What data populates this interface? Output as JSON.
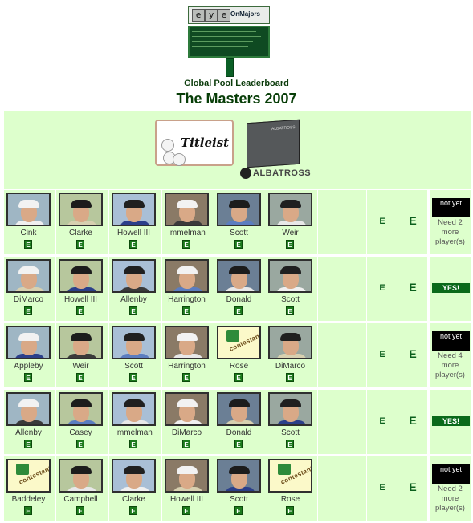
{
  "header": {
    "logo_letters": [
      "e",
      "y",
      "e"
    ],
    "logo_word": "OnMajors",
    "subtitle": "Global Pool Leaderboard",
    "title": "The Masters 2007"
  },
  "banner": {
    "ball_brand": "Titleist",
    "sponsor": "ALBATROSS"
  },
  "rows": [
    {
      "players": [
        "Cink",
        "Clarke",
        "Howell III",
        "Immelman",
        "Scott",
        "Weir"
      ],
      "score1": "E",
      "score2": "E",
      "status": {
        "type": "notyet",
        "badge": "not yet",
        "note": "Need 2 more player(s)"
      }
    },
    {
      "players": [
        "DiMarco",
        "Howell III",
        "Allenby",
        "Harrington",
        "Donald",
        "Scott"
      ],
      "score1": "E",
      "score2": "E",
      "status": {
        "type": "yes",
        "badge": "YES!"
      }
    },
    {
      "players": [
        "Appleby",
        "Weir",
        "Scott",
        "Harrington",
        "Rose",
        "DiMarco"
      ],
      "contestant": [
        false,
        false,
        false,
        false,
        true,
        false
      ],
      "score1": "E",
      "score2": "E",
      "status": {
        "type": "notyet",
        "badge": "not yet",
        "note": "Need 4 more player(s)"
      }
    },
    {
      "players": [
        "Allenby",
        "Casey",
        "Immelman",
        "DiMarco",
        "Donald",
        "Scott"
      ],
      "score1": "E",
      "score2": "E",
      "status": {
        "type": "yes",
        "badge": "YES!"
      }
    },
    {
      "players": [
        "Baddeley",
        "Campbell",
        "Clarke",
        "Howell III",
        "Scott",
        "Rose"
      ],
      "contestant": [
        true,
        false,
        false,
        false,
        false,
        true
      ],
      "score1": "E",
      "score2": "E",
      "status": {
        "type": "notyet",
        "badge": "not yet",
        "note": "Need 2 more player(s)"
      }
    }
  ],
  "player_badge": "E",
  "contestant_label": "contestant",
  "colors": {
    "cell_bg": "#ddffcc",
    "title_green": "#073d07",
    "badge_green": "#1c7a1c",
    "yes_green": "#0a6a1a"
  }
}
